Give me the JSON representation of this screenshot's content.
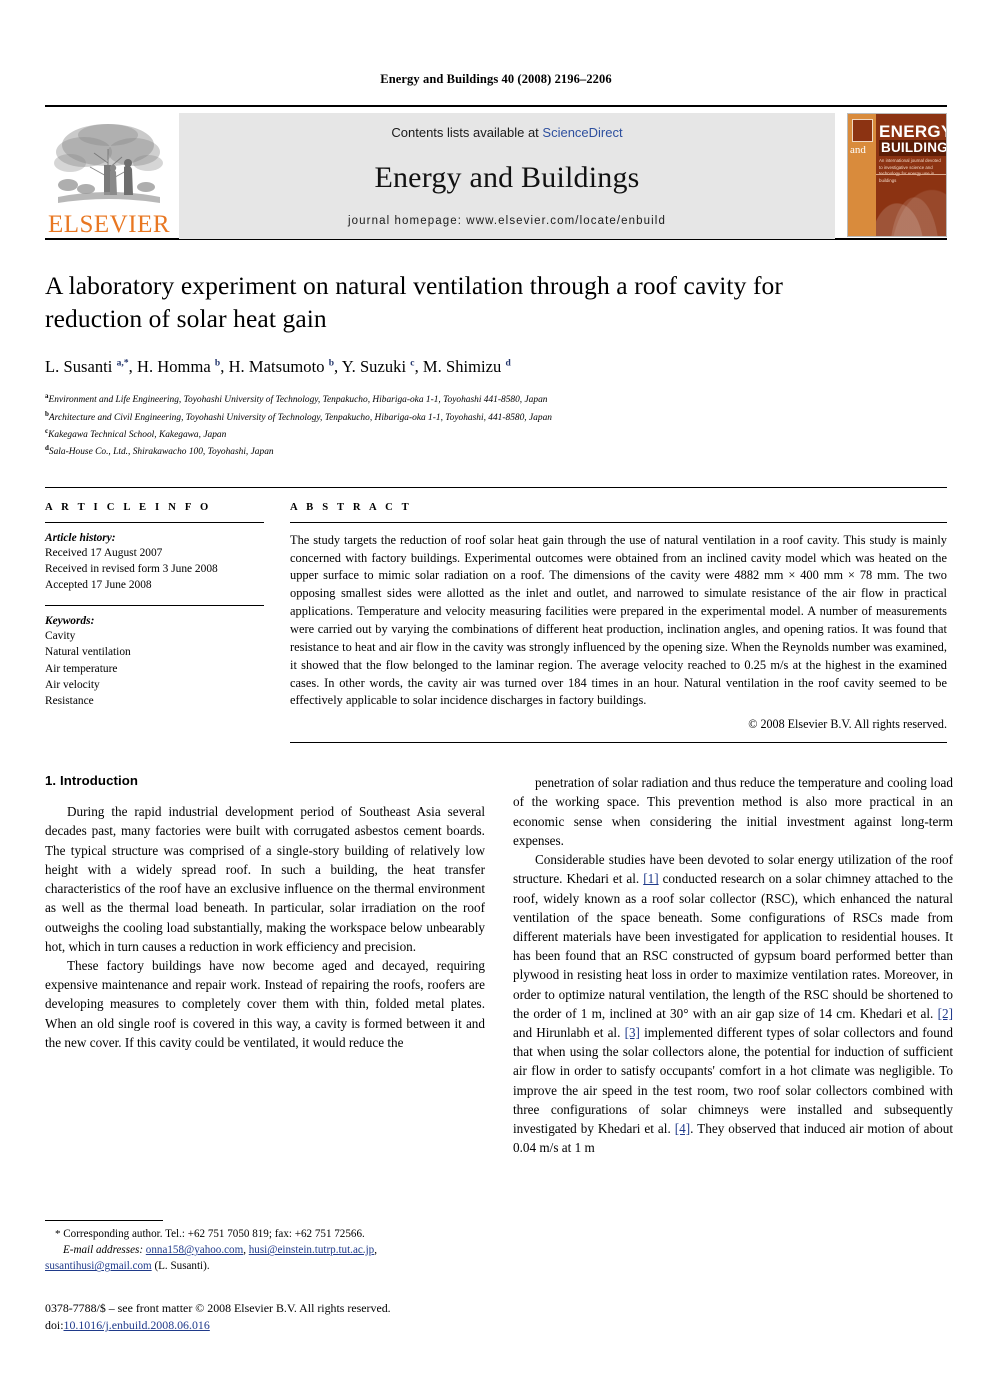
{
  "running_head": "Energy and Buildings 40 (2008) 2196–2206",
  "masthead": {
    "publisher_name": "ELSEVIER",
    "contents_prefix": "Contents lists available at ",
    "contents_link": "ScienceDirect",
    "journal_title": "Energy and Buildings",
    "homepage_line": "journal homepage: www.elsevier.com/locate/enbuild",
    "cover": {
      "energy": "ENERGY",
      "and": "and",
      "buildings": "BUILDINGS",
      "subtitle": "An international journal devoted to investigative science and technology for energy use in buildings"
    },
    "link_color": "#2d4f9e",
    "elsevier_orange": "#e87722"
  },
  "article": {
    "title": "A laboratory experiment on natural ventilation through a roof cavity for reduction of solar heat gain",
    "authors_html": "L. Susanti <sup>a,*</sup>, H. Homma <sup>b</sup>, H. Matsumoto <sup>b</sup>, Y. Suzuki <sup>c</sup>, M. Shimizu <sup>d</sup>",
    "affiliations": [
      {
        "marker": "a",
        "text": "Environment and Life Engineering, Toyohashi University of Technology, Tenpakucho, Hibariga-oka 1-1, Toyohashi 441-8580, Japan"
      },
      {
        "marker": "b",
        "text": "Architecture and Civil Engineering, Toyohashi University of Technology, Tenpakucho, Hibariga-oka 1-1, Toyohashi, 441-8580, Japan"
      },
      {
        "marker": "c",
        "text": "Kakegawa Technical School, Kakegawa, Japan"
      },
      {
        "marker": "d",
        "text": "Sala-House Co., Ltd., Shirakawacho 100, Toyohashi, Japan"
      }
    ]
  },
  "article_info": {
    "heading": "A R T I C L E  I N F O",
    "history_label": "Article history:",
    "history": [
      "Received 17 August 2007",
      "Received in revised form 3 June 2008",
      "Accepted 17 June 2008"
    ],
    "keywords_label": "Keywords:",
    "keywords": [
      "Cavity",
      "Natural ventilation",
      "Air temperature",
      "Air velocity",
      "Resistance"
    ]
  },
  "abstract": {
    "heading": "A B S T R A C T",
    "text": "The study targets the reduction of roof solar heat gain through the use of natural ventilation in a roof cavity. This study is mainly concerned with factory buildings. Experimental outcomes were obtained from an inclined cavity model which was heated on the upper surface to mimic solar radiation on a roof. The dimensions of the cavity were 4882 mm × 400 mm × 78 mm. The two opposing smallest sides were allotted as the inlet and outlet, and narrowed to simulate resistance of the air flow in practical applications. Temperature and velocity measuring facilities were prepared in the experimental model. A number of measurements were carried out by varying the combinations of different heat production, inclination angles, and opening ratios. It was found that resistance to heat and air flow in the cavity was strongly influenced by the opening size. When the Reynolds number was examined, it showed that the flow belonged to the laminar region. The average velocity reached to 0.25 m/s at the highest in the examined cases. In other words, the cavity air was turned over 184 times in an hour. Natural ventilation in the roof cavity seemed to be effectively applicable to solar incidence discharges in factory buildings.",
    "copyright": "© 2008 Elsevier B.V. All rights reserved."
  },
  "body": {
    "section_number_title": "1. Introduction",
    "left_paragraphs": [
      "During the rapid industrial development period of Southeast Asia several decades past, many factories were built with corrugated asbestos cement boards. The typical structure was comprised of a single-story building of relatively low height with a widely spread roof. In such a building, the heat transfer characteristics of the roof have an exclusive influence on the thermal environment as well as the thermal load beneath. In particular, solar irradiation on the roof outweighs the cooling load substantially, making the workspace below unbearably hot, which in turn causes a reduction in work efficiency and precision.",
      "These factory buildings have now become aged and decayed, requiring expensive maintenance and repair work. Instead of repairing the roofs, roofers are developing measures to completely cover them with thin, folded metal plates. When an old single roof is covered in this way, a cavity is formed between it and the new cover. If this cavity could be ventilated, it would reduce the"
    ],
    "right_paragraph_1": "penetration of solar radiation and thus reduce the temperature and cooling load of the working space. This prevention method is also more practical in an economic sense when considering the initial investment against long-term expenses.",
    "right_paragraph_2_parts": {
      "p1": "Considerable studies have been devoted to solar energy utilization of the roof structure. Khedari et al. ",
      "ref1": "[1]",
      "p2": " conducted research on a solar chimney attached to the roof, widely known as a roof solar collector (RSC), which enhanced the natural ventilation of the space beneath. Some configurations of RSCs made from different materials have been investigated for application to residential houses. It has been found that an RSC constructed of gypsum board performed better than plywood in resisting heat loss in order to maximize ventilation rates. Moreover, in order to optimize natural ventilation, the length of the RSC should be shortened to the order of 1 m, inclined at 30° with an air gap size of 14 cm. Khedari et al. ",
      "ref2": "[2]",
      "p3": " and Hirunlabh et al. ",
      "ref3": "[3]",
      "p4": " implemented different types of solar collectors and found that when using the solar collectors alone, the potential for induction of sufficient air flow in order to satisfy occupants' comfort in a hot climate was negligible. To improve the air speed in the test room, two roof solar collectors combined with three configurations of solar chimneys were installed and subsequently investigated by Khedari et al. ",
      "ref4": "[4]",
      "p5": ". They observed that induced air motion of about 0.04 m/s at 1 m"
    }
  },
  "footnotes": {
    "corresponding": "Corresponding author. Tel.: +62 751 7050 819; fax: +62 751 72566.",
    "email_label": "E-mail addresses:",
    "emails": [
      "onna158@yahoo.com",
      "husi@einstein.tutrp.tut.ac.jp",
      "susantihusi@gmail.com"
    ],
    "email_suffix": "(L. Susanti).",
    "issn_line": "0378-7788/$ – see front matter © 2008 Elsevier B.V. All rights reserved.",
    "doi_label": "doi:",
    "doi_value": "10.1016/j.enbuild.2008.06.016"
  }
}
